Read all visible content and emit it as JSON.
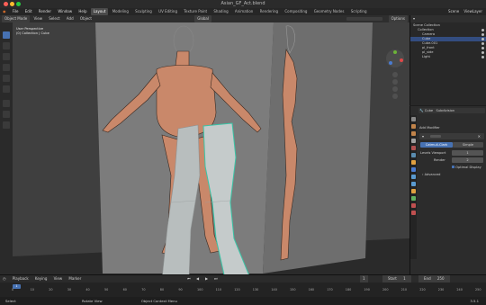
{
  "window": {
    "title": "Asian_GF_Act.blend"
  },
  "menu": {
    "items": [
      "File",
      "Edit",
      "Render",
      "Window",
      "Help"
    ]
  },
  "workspaces": [
    "Layout",
    "Modeling",
    "Sculpting",
    "UV Editing",
    "Texture Paint",
    "Shading",
    "Animation",
    "Rendering",
    "Compositing",
    "Geometry Nodes",
    "Scripting"
  ],
  "active_workspace": "Layout",
  "topright": {
    "scene": "Scene",
    "view_layer": "ViewLayer"
  },
  "viewport_header": {
    "mode": "Object Mode",
    "view": "View",
    "select": "Select",
    "add": "Add",
    "object": "Object",
    "global": "Global",
    "options": "Options"
  },
  "viewport": {
    "info_line1": "User Perspective",
    "info_line2": "(0) Collection | Cube"
  },
  "outliner": {
    "header": "Scene Collection",
    "rows": [
      {
        "label": "Scene Collection",
        "indent": 0,
        "selected": false
      },
      {
        "label": "Collection",
        "indent": 1,
        "selected": false
      },
      {
        "label": "Camera",
        "indent": 2,
        "selected": false
      },
      {
        "label": "Cube",
        "indent": 2,
        "selected": true
      },
      {
        "label": "Cube.001",
        "indent": 2,
        "selected": false
      },
      {
        "label": "pl_front",
        "indent": 2,
        "selected": false
      },
      {
        "label": "pl_side",
        "indent": 2,
        "selected": false
      },
      {
        "label": "Light",
        "indent": 2,
        "selected": false
      }
    ]
  },
  "properties": {
    "object_name": "Cube",
    "modifier_tab": "Subdivision",
    "add_modifier": "Add Modifier",
    "catmull": "Catmull-Clark",
    "simple": "Simple",
    "levels_viewport_label": "Levels Viewport",
    "levels_viewport": "1",
    "render_label": "Render",
    "render": "2",
    "optimal_display": "Optimal Display",
    "advanced": "Advanced"
  },
  "timeline": {
    "menu": [
      "Playback",
      "Keying",
      "View",
      "Marker"
    ],
    "current_frame": "1",
    "start_label": "Start",
    "start": "1",
    "end_label": "End",
    "end": "250",
    "frames": [
      "0",
      "10",
      "20",
      "30",
      "40",
      "50",
      "60",
      "70",
      "80",
      "90",
      "100",
      "110",
      "120",
      "130",
      "140",
      "150",
      "160",
      "170",
      "180",
      "190",
      "200",
      "210",
      "220",
      "230",
      "240",
      "250"
    ]
  },
  "status": {
    "select": "Select",
    "rotate": "Rotate View",
    "context": "Object Context Menu",
    "version": "3.5.1"
  },
  "colors": {
    "accent": "#4772b3",
    "selection_outline": "#39c5a6",
    "viewport_bg": "#3f3f3f",
    "skin": "#c9886a"
  }
}
